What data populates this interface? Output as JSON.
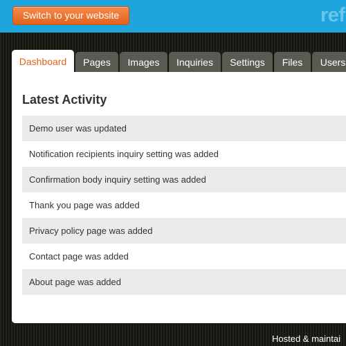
{
  "header": {
    "switch_button": "Switch to your website",
    "logo": "refi"
  },
  "tabs": [
    {
      "label": "Dashboard",
      "active": true
    },
    {
      "label": "Pages"
    },
    {
      "label": "Images"
    },
    {
      "label": "Inquiries"
    },
    {
      "label": "Settings"
    },
    {
      "label": "Files"
    },
    {
      "label": "Users"
    }
  ],
  "main": {
    "title": "Latest Activity",
    "activity": [
      "Demo user was updated",
      "Notification recipients inquiry setting was added",
      "Confirmation body inquiry setting was added",
      "Thank you page was added",
      "Privacy policy page was added",
      "Contact page was added",
      "About page was added"
    ]
  },
  "footer": {
    "text": "Hosted & maintai"
  },
  "colors": {
    "topbar": "#1fa5de",
    "accent": "#e2621c",
    "tab_inactive": "#5a5a52"
  }
}
